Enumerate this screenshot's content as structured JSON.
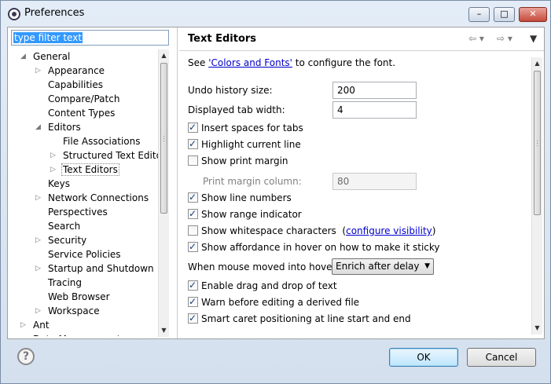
{
  "window": {
    "title": "Preferences",
    "controls": {
      "minimize": "–",
      "maximize": "□",
      "close": "✕"
    }
  },
  "filter": {
    "value": "type filter text"
  },
  "tree": [
    {
      "label": "General",
      "depth": 0,
      "state": "expanded"
    },
    {
      "label": "Appearance",
      "depth": 1,
      "state": "collapsed"
    },
    {
      "label": "Capabilities",
      "depth": 1,
      "state": "leaf"
    },
    {
      "label": "Compare/Patch",
      "depth": 1,
      "state": "leaf"
    },
    {
      "label": "Content Types",
      "depth": 1,
      "state": "leaf"
    },
    {
      "label": "Editors",
      "depth": 1,
      "state": "expanded"
    },
    {
      "label": "File Associations",
      "depth": 2,
      "state": "leaf"
    },
    {
      "label": "Structured Text Editors",
      "depth": 2,
      "state": "collapsed"
    },
    {
      "label": "Text Editors",
      "depth": 2,
      "state": "collapsed",
      "selected": true
    },
    {
      "label": "Keys",
      "depth": 1,
      "state": "leaf"
    },
    {
      "label": "Network Connections",
      "depth": 1,
      "state": "collapsed"
    },
    {
      "label": "Perspectives",
      "depth": 1,
      "state": "leaf"
    },
    {
      "label": "Search",
      "depth": 1,
      "state": "leaf"
    },
    {
      "label": "Security",
      "depth": 1,
      "state": "collapsed"
    },
    {
      "label": "Service Policies",
      "depth": 1,
      "state": "leaf"
    },
    {
      "label": "Startup and Shutdown",
      "depth": 1,
      "state": "collapsed"
    },
    {
      "label": "Tracing",
      "depth": 1,
      "state": "leaf"
    },
    {
      "label": "Web Browser",
      "depth": 1,
      "state": "leaf"
    },
    {
      "label": "Workspace",
      "depth": 1,
      "state": "collapsed"
    },
    {
      "label": "Ant",
      "depth": 0,
      "state": "collapsed"
    },
    {
      "label": "Data Management",
      "depth": 0,
      "state": "collapsed"
    }
  ],
  "page": {
    "title": "Text Editors",
    "see_prefix": "See ",
    "see_link": "'Colors and Fonts'",
    "see_suffix": " to configure the font.",
    "undo_label": "Undo history size:",
    "undo_value": "200",
    "tab_label": "Displayed tab width:",
    "tab_value": "4",
    "insert_spaces": "Insert spaces for tabs",
    "highlight_line": "Highlight current line",
    "show_print_margin": "Show print margin",
    "print_margin_label": "Print margin column:",
    "print_margin_value": "80",
    "show_line_numbers": "Show line numbers",
    "show_range": "Show range indicator",
    "show_whitespace": "Show whitespace characters",
    "whitespace_open": "(",
    "configure_visibility": "configure visibility",
    "whitespace_close": ")",
    "show_affordance": "Show affordance in hover on how to make it sticky",
    "hover_label": "When mouse moved into hover:",
    "hover_value": "Enrich after delay",
    "drag_drop": "Enable drag and drop of text",
    "warn_derived": "Warn before editing a derived file",
    "smart_caret": "Smart caret positioning at line start and end"
  },
  "buttons": {
    "help": "?",
    "ok": "OK",
    "cancel": "Cancel"
  }
}
